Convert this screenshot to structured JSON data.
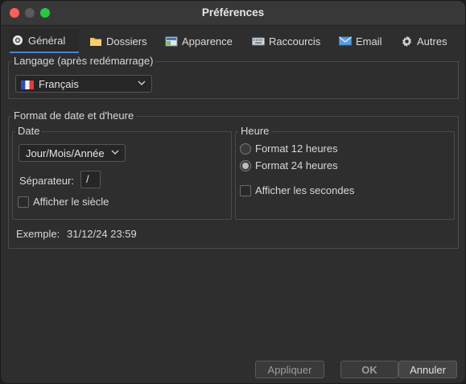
{
  "window": {
    "title": "Préférences"
  },
  "tabs": [
    {
      "label": "Général",
      "icon": "general-icon"
    },
    {
      "label": "Dossiers",
      "icon": "folder-icon"
    },
    {
      "label": "Apparence",
      "icon": "appearance-icon"
    },
    {
      "label": "Raccourcis",
      "icon": "keyboard-icon"
    },
    {
      "label": "Email",
      "icon": "mail-icon"
    },
    {
      "label": "Autres",
      "icon": "gear-icon"
    }
  ],
  "language": {
    "group_label": "Langage (après redémarrage)",
    "selected": "Français",
    "flag_icon": "france-flag-icon"
  },
  "datetime": {
    "group_label": "Format de date et d'heure",
    "date": {
      "group_label": "Date",
      "format_selected": "Jour/Mois/Année",
      "separator_label": "Séparateur:",
      "separator_value": "/",
      "century_label": "Afficher le siècle"
    },
    "time": {
      "group_label": "Heure",
      "format12_label": "Format 12 heures",
      "format24_label": "Format 24 heures",
      "selected": "24",
      "seconds_label": "Afficher les secondes"
    },
    "example_label": "Exemple:",
    "example_value": "31/12/24 23:59"
  },
  "buttons": {
    "apply": "Appliquer",
    "ok": "OK",
    "cancel": "Annuler"
  },
  "colors": {
    "accent": "#4a86c8",
    "background": "#2e2e2e",
    "text": "#d8d8d8"
  }
}
